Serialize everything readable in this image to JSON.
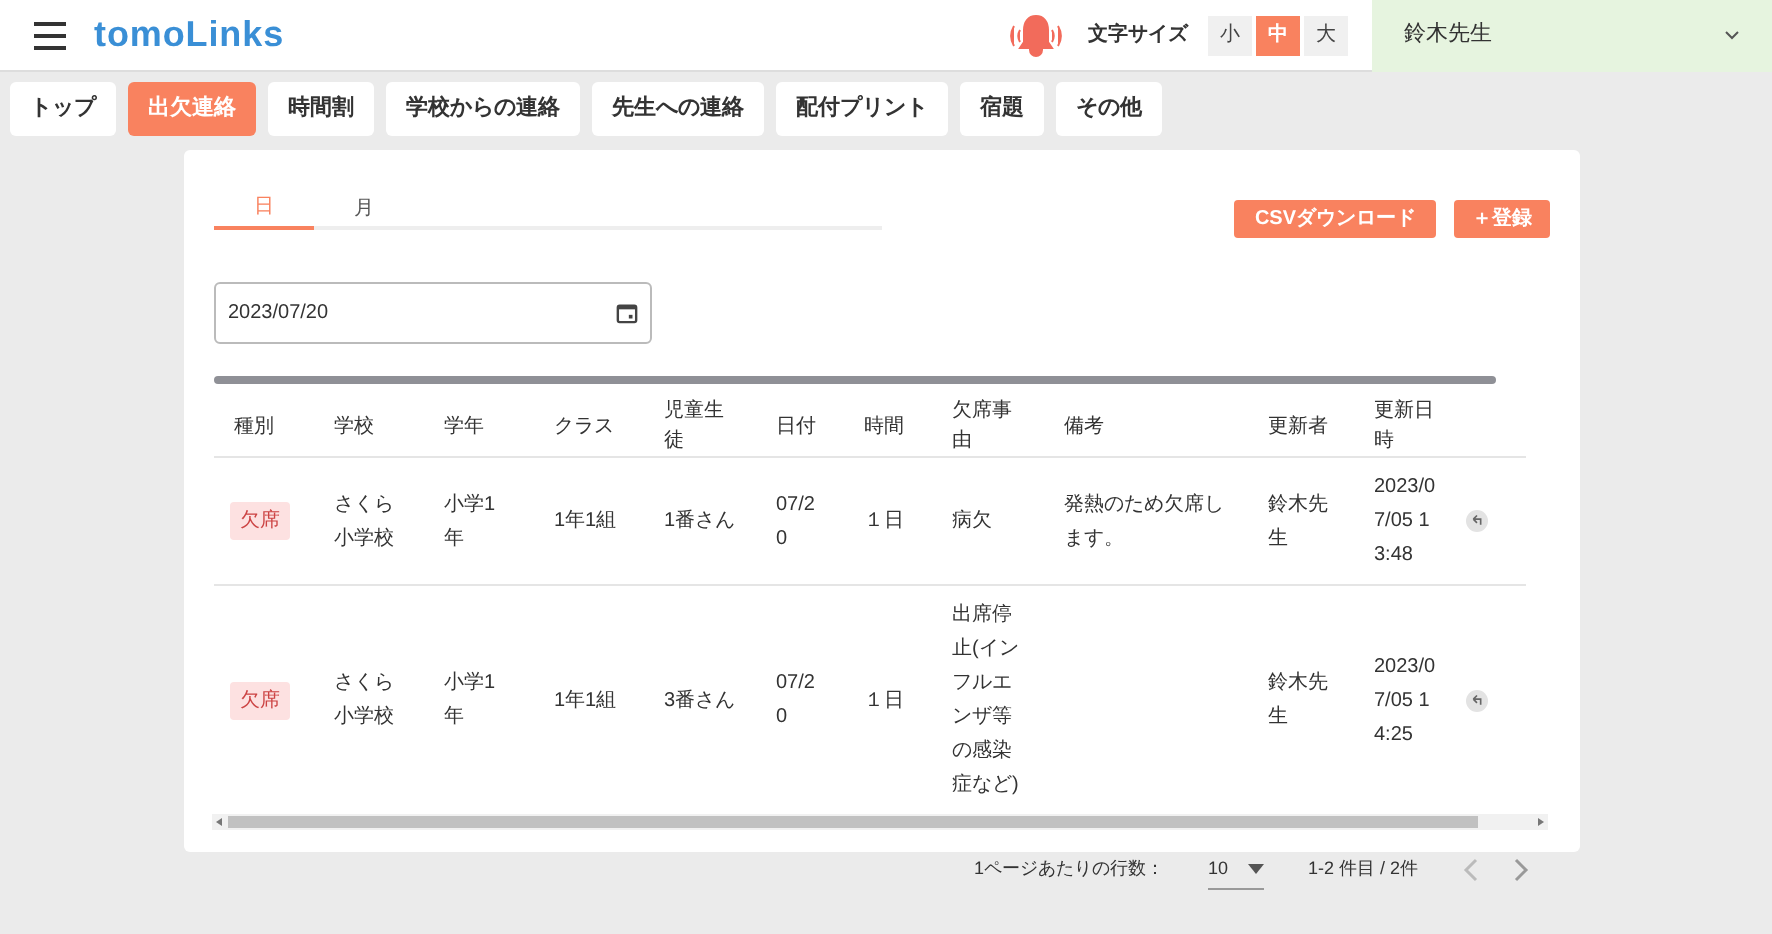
{
  "header": {
    "logo": "tomoLinks",
    "font_size_label": "文字サイズ",
    "font_sizes": [
      {
        "label": "小",
        "selected": false
      },
      {
        "label": "中",
        "selected": true
      },
      {
        "label": "大",
        "selected": false
      }
    ],
    "user": "鈴木先生"
  },
  "nav_tabs": [
    {
      "label": "トップ",
      "selected": false
    },
    {
      "label": "出欠連絡",
      "selected": true
    },
    {
      "label": "時間割",
      "selected": false
    },
    {
      "label": "学校からの連絡",
      "selected": false
    },
    {
      "label": "先生への連絡",
      "selected": false
    },
    {
      "label": "配付プリント",
      "selected": false
    },
    {
      "label": "宿題",
      "selected": false
    },
    {
      "label": "その他",
      "selected": false
    }
  ],
  "view_tabs": [
    {
      "label": "日",
      "selected": true
    },
    {
      "label": "月",
      "selected": false
    }
  ],
  "buttons": {
    "csv": "CSVダウンロード",
    "add": "＋登録"
  },
  "date_field": {
    "value": "2023/07/20"
  },
  "table": {
    "columns": [
      "種別",
      "学校",
      "学年",
      "クラス",
      "児童生徒",
      "日付",
      "時間",
      "欠席事由",
      "備考",
      "更新者",
      "更新日時"
    ],
    "rows": [
      {
        "type": "欠席",
        "school": "さくら小学校",
        "grade": "小学1年",
        "class": "1年1組",
        "student": "1番さん",
        "date": "07/20",
        "time": "１日",
        "reason": "病欠",
        "note": "発熱のため欠席します。",
        "updater": "鈴木先生",
        "updated": "2023/07/05 13:48"
      },
      {
        "type": "欠席",
        "school": "さくら小学校",
        "grade": "小学1年",
        "class": "1年1組",
        "student": "3番さん",
        "date": "07/20",
        "time": "１日",
        "reason": "出席停止(インフルエンザ等の感染症など)",
        "note": "",
        "updater": "鈴木先生",
        "updated": "2023/07/05 14:25"
      }
    ]
  },
  "pagination": {
    "rows_label": "1ページあたりの行数：",
    "rows_value": "10",
    "range": "1-2 件目 / 2件"
  }
}
